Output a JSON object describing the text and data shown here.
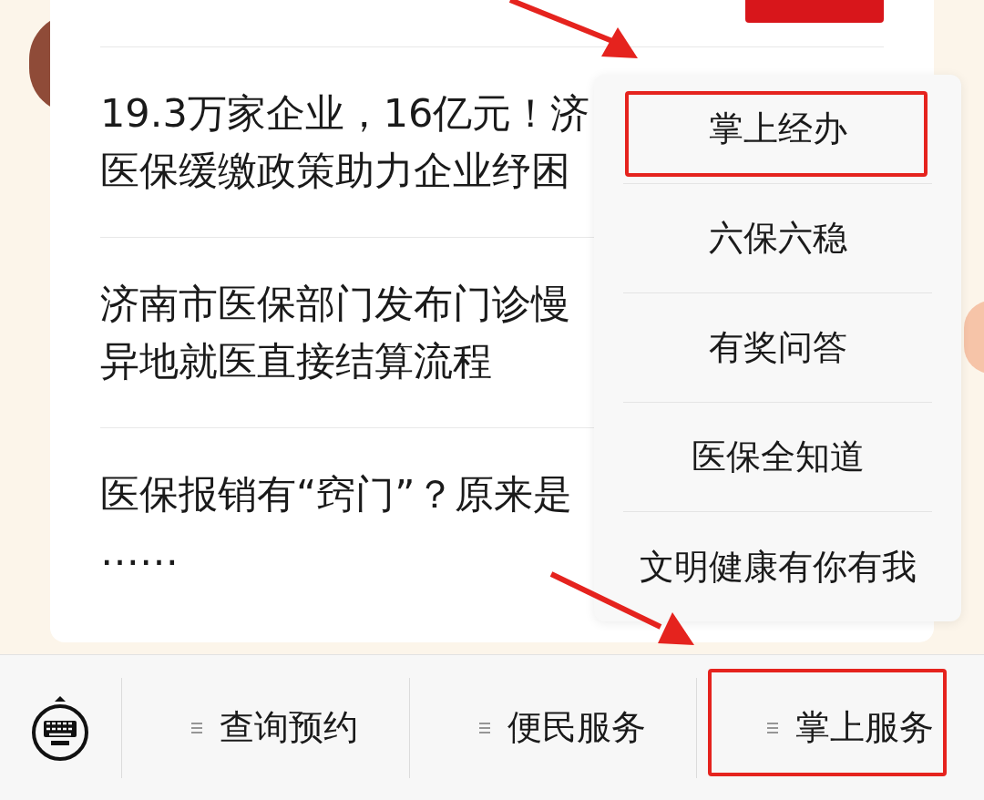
{
  "articles": [
    {
      "lines": [
        "19.3万家企业，16亿元！济",
        "医保缓缴政策助力企业纾困"
      ]
    },
    {
      "lines": [
        "济南市医保部门发布门诊慢",
        "异地就医直接结算流程"
      ]
    },
    {
      "lines": [
        "医保报销有“窍门”？原来是",
        "……"
      ]
    }
  ],
  "menu": {
    "items": [
      {
        "label": "掌上经办",
        "annotated": true
      },
      {
        "label": "六保六稳",
        "annotated": false
      },
      {
        "label": "有奖问答",
        "annotated": false
      },
      {
        "label": "医保全知道",
        "annotated": false
      },
      {
        "label": "文明健康有你有我",
        "annotated": false
      }
    ]
  },
  "tabs": [
    {
      "label": "查询预约",
      "annotated": false
    },
    {
      "label": "便民服务",
      "annotated": false
    },
    {
      "label": "掌上服务",
      "annotated": true
    }
  ]
}
